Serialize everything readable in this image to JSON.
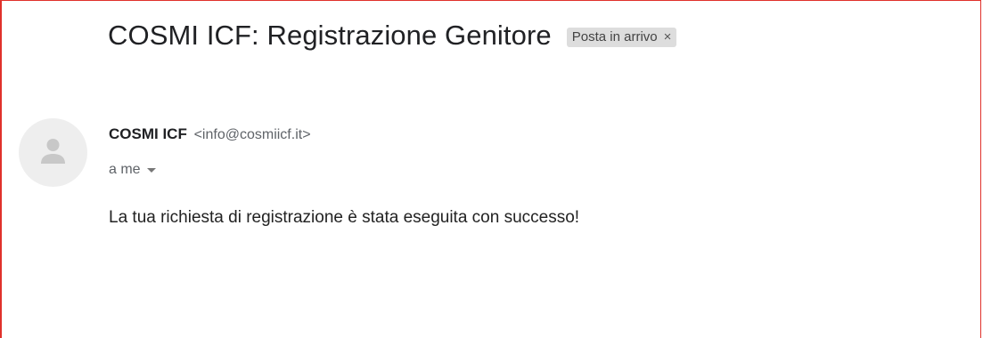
{
  "email": {
    "subject": "COSMI ICF: Registrazione Genitore",
    "label": {
      "text": "Posta in arrivo",
      "remove_glyph": "×"
    },
    "sender": {
      "name": "COSMI ICF",
      "email": "<info@cosmiicf.it>",
      "avatar_icon": "person-icon"
    },
    "recipient": {
      "text": "a me",
      "details_icon": "caret-down-icon"
    },
    "body": "La tua richiesta di registrazione è stata eseguita con successo!"
  },
  "colors": {
    "frame_border": "#e0312b",
    "label_chip_bg": "#dddddd",
    "avatar_bg": "#eeeeee",
    "avatar_icon": "#c8c8c8"
  }
}
